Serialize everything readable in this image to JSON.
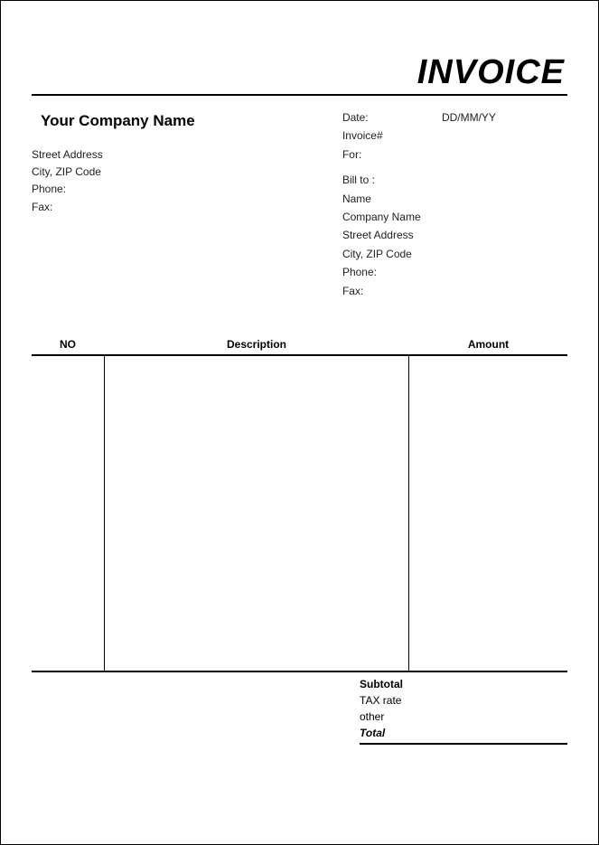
{
  "title": "INVOICE",
  "company": {
    "name": "Your Company Name",
    "street": "Street Address",
    "city_zip": "City,  ZIP Code",
    "phone_label": "Phone:",
    "fax_label": "Fax:"
  },
  "meta": {
    "date_label": "Date:",
    "date_value": "DD/MM/YY",
    "invoice_label": "Invoice#",
    "for_label": "For:"
  },
  "bill_to": {
    "heading": "Bill to :",
    "name": "Name",
    "company": "Company Name",
    "street": "Street Address",
    "city_zip": "City,  ZIP Code",
    "phone_label": "Phone:",
    "fax_label": "Fax:"
  },
  "table": {
    "headers": {
      "no": "NO",
      "description": "Description",
      "amount": "Amount"
    }
  },
  "totals": {
    "subtotal": "Subtotal",
    "tax": "TAX rate",
    "other": "other",
    "total": "Total"
  }
}
